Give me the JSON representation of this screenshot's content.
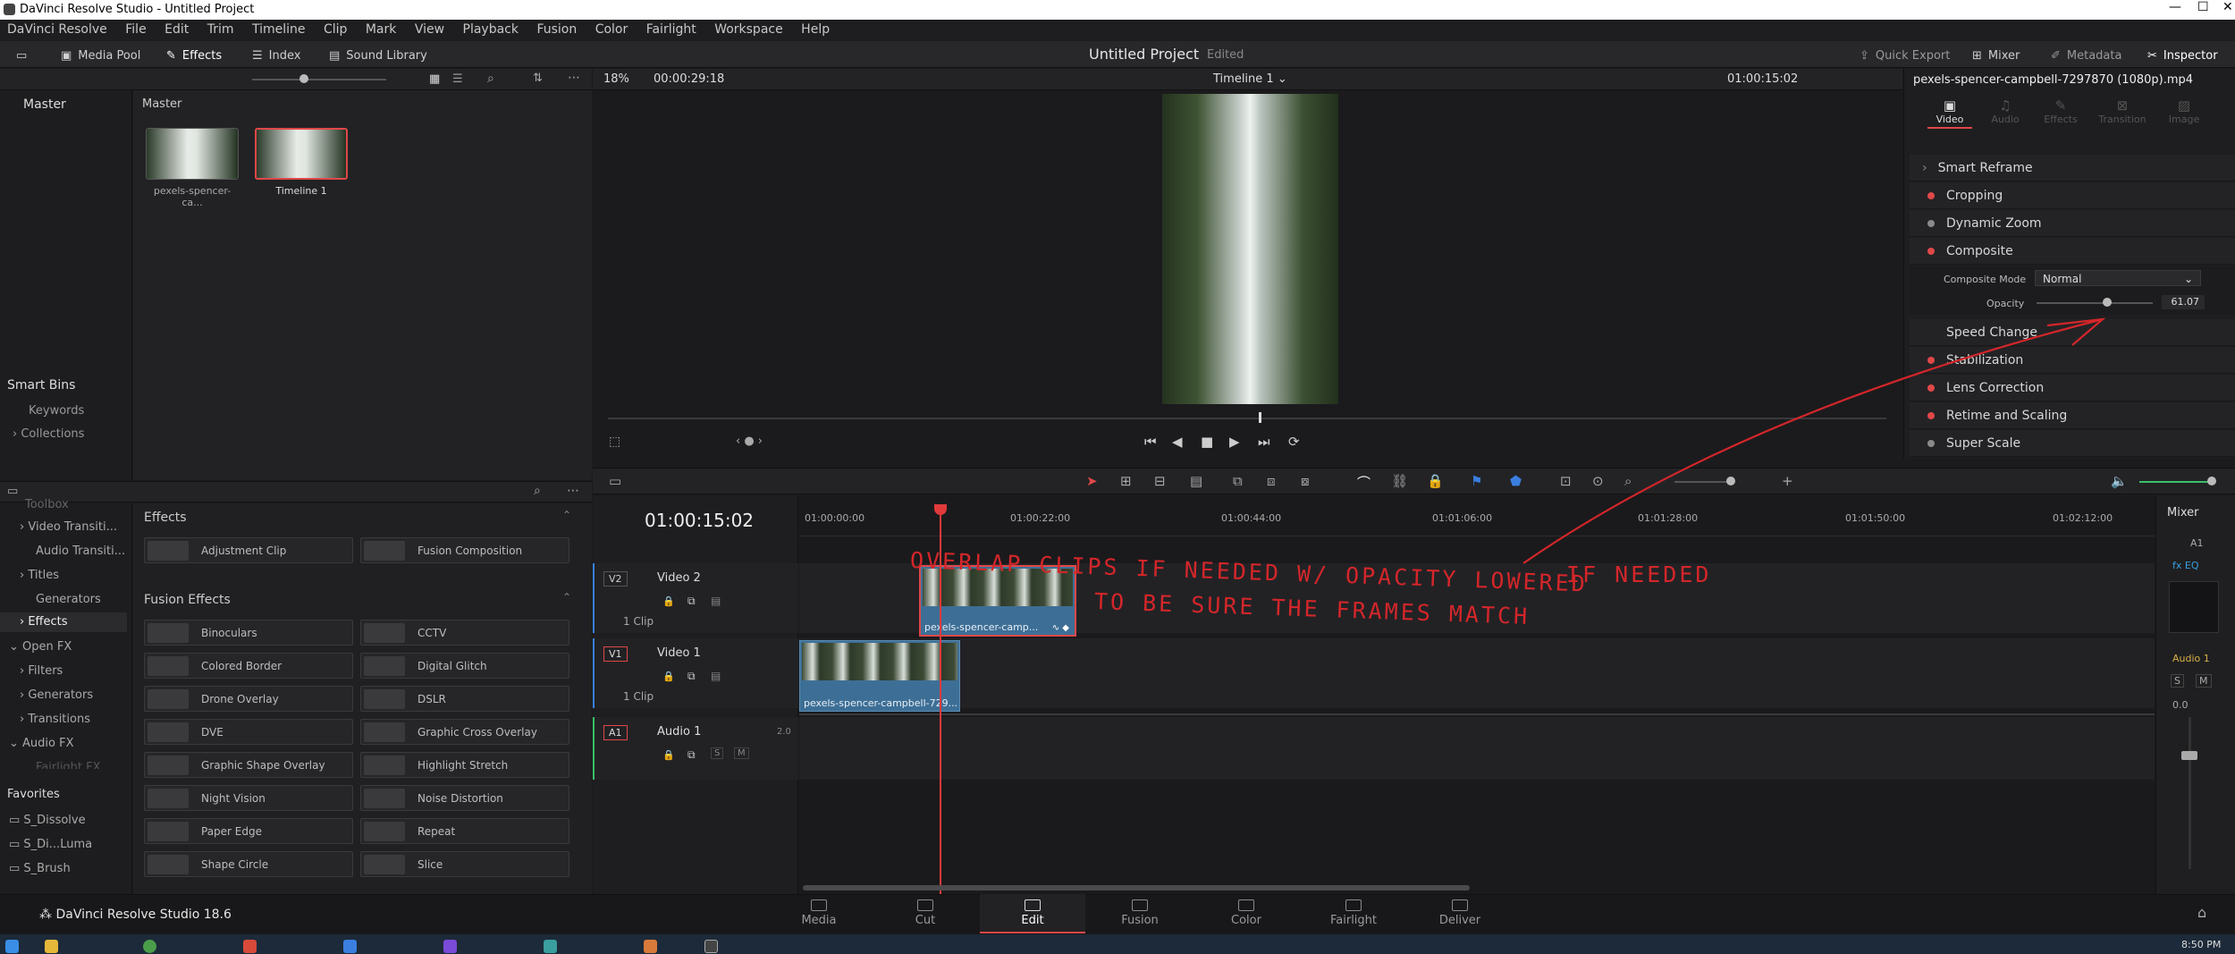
{
  "window": {
    "title": "DaVinci Resolve Studio - Untitled Project"
  },
  "menu": [
    "DaVinci Resolve",
    "File",
    "Edit",
    "Trim",
    "Timeline",
    "Clip",
    "Mark",
    "View",
    "Playback",
    "Fusion",
    "Color",
    "Fairlight",
    "Workspace",
    "Help"
  ],
  "toolbar": {
    "media_pool": "Media Pool",
    "effects": "Effects",
    "index": "Index",
    "sound_library": "Sound Library",
    "project_title": "Untitled Project",
    "project_status": "Edited",
    "quick_export": "Quick Export",
    "mixer": "Mixer",
    "metadata": "Metadata",
    "inspector": "Inspector"
  },
  "media_pool": {
    "sidebar_master": "Master",
    "bin_header": "Master",
    "items": [
      {
        "label": "pexels-spencer-ca..."
      },
      {
        "label": "Timeline 1"
      }
    ],
    "smart_bins": "Smart Bins",
    "keywords": "Keywords",
    "collections": "Collections"
  },
  "viewer": {
    "zoom": "18%",
    "timecode": "00:00:29:18",
    "timeline_name": "Timeline 1",
    "current_tc": "01:00:15:02"
  },
  "effects_tree": {
    "items": [
      "Toolbox",
      "Video Transiti...",
      "Audio Transiti...",
      "Titles",
      "Generators",
      "Effects",
      "Open FX",
      "Filters",
      "Generators",
      "Transitions",
      "Audio FX",
      "Fairlight FX"
    ],
    "favorites_title": "Favorites",
    "favorites": [
      "S_Dissolve",
      "S_Di...Luma",
      "S_Brush"
    ]
  },
  "effects_panel": {
    "section_effects": "Effects",
    "effects": [
      "Adjustment Clip",
      "Fusion Composition"
    ],
    "section_fusion": "Fusion Effects",
    "fusion": [
      "Binoculars",
      "CCTV",
      "Colored Border",
      "Digital Glitch",
      "Drone Overlay",
      "DSLR",
      "DVE",
      "Graphic Cross Overlay",
      "Graphic Shape Overlay",
      "Highlight Stretch",
      "Night Vision",
      "Noise Distortion",
      "Paper Edge",
      "Repeat",
      "Shape Circle",
      "Slice"
    ]
  },
  "timeline": {
    "timecode": "01:00:15:02",
    "ruler": [
      "01:00:00:00",
      "01:00:22:00",
      "01:00:44:00",
      "01:01:06:00",
      "01:01:28:00",
      "01:01:50:00",
      "01:02:12:00"
    ],
    "tracks": [
      {
        "id": "V2",
        "name": "Video 2",
        "clips": "1 Clip"
      },
      {
        "id": "V1",
        "name": "Video 1",
        "clips": "1 Clip"
      },
      {
        "id": "A1",
        "name": "Audio 1",
        "channels": "2.0"
      }
    ],
    "clip_v2": "pexels-spencer-camp...",
    "clip_v1": "pexels-spencer-campbell-729...8",
    "annotation_line1": "OVERLAP CLIPS IF NEEDED W/ OPACITY LOWERED",
    "annotation_line2": "TO BE SURE THE FRAMES MATCH",
    "annotation_side": "IF NEEDED"
  },
  "mixer": {
    "title": "Mixer",
    "channel": "A1",
    "track": "Audio 1",
    "level": "0.0"
  },
  "inspector": {
    "clip_name": "pexels-spencer-campbell-7297870 (1080p).mp4",
    "tabs": [
      "Video",
      "Audio",
      "Effects",
      "Transition",
      "Image"
    ],
    "rows": [
      "Smart Reframe",
      "Cropping",
      "Dynamic Zoom",
      "Composite",
      "Speed Change",
      "Stabilization",
      "Lens Correction",
      "Retime and Scaling",
      "Super Scale"
    ],
    "composite_mode_label": "Composite Mode",
    "composite_mode_value": "Normal",
    "opacity_label": "Opacity",
    "opacity_value": "61.07"
  },
  "pages": [
    "Media",
    "Cut",
    "Edit",
    "Fusion",
    "Color",
    "Fairlight",
    "Deliver"
  ],
  "footer": {
    "app_name": "DaVinci Resolve Studio 18.6",
    "clock": "8:50 PM"
  },
  "colors": {
    "accent_red": "#e04848",
    "annotation_red": "#d4262a",
    "clip_blue": "#3d6f96",
    "playhead": "#e03a3a"
  }
}
